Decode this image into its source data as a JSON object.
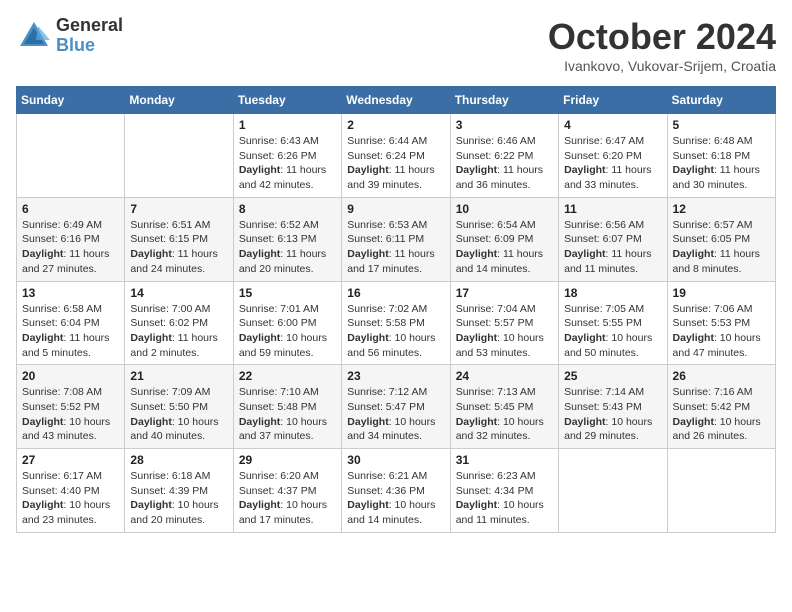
{
  "logo": {
    "general": "General",
    "blue": "Blue"
  },
  "title": "October 2024",
  "location": "Ivankovo, Vukovar-Srijem, Croatia",
  "days_of_week": [
    "Sunday",
    "Monday",
    "Tuesday",
    "Wednesday",
    "Thursday",
    "Friday",
    "Saturday"
  ],
  "weeks": [
    [
      {
        "day": null,
        "data": null
      },
      {
        "day": null,
        "data": null
      },
      {
        "day": "1",
        "data": "Sunrise: 6:43 AM\nSunset: 6:26 PM\nDaylight: 11 hours and 42 minutes."
      },
      {
        "day": "2",
        "data": "Sunrise: 6:44 AM\nSunset: 6:24 PM\nDaylight: 11 hours and 39 minutes."
      },
      {
        "day": "3",
        "data": "Sunrise: 6:46 AM\nSunset: 6:22 PM\nDaylight: 11 hours and 36 minutes."
      },
      {
        "day": "4",
        "data": "Sunrise: 6:47 AM\nSunset: 6:20 PM\nDaylight: 11 hours and 33 minutes."
      },
      {
        "day": "5",
        "data": "Sunrise: 6:48 AM\nSunset: 6:18 PM\nDaylight: 11 hours and 30 minutes."
      }
    ],
    [
      {
        "day": "6",
        "data": "Sunrise: 6:49 AM\nSunset: 6:16 PM\nDaylight: 11 hours and 27 minutes."
      },
      {
        "day": "7",
        "data": "Sunrise: 6:51 AM\nSunset: 6:15 PM\nDaylight: 11 hours and 24 minutes."
      },
      {
        "day": "8",
        "data": "Sunrise: 6:52 AM\nSunset: 6:13 PM\nDaylight: 11 hours and 20 minutes."
      },
      {
        "day": "9",
        "data": "Sunrise: 6:53 AM\nSunset: 6:11 PM\nDaylight: 11 hours and 17 minutes."
      },
      {
        "day": "10",
        "data": "Sunrise: 6:54 AM\nSunset: 6:09 PM\nDaylight: 11 hours and 14 minutes."
      },
      {
        "day": "11",
        "data": "Sunrise: 6:56 AM\nSunset: 6:07 PM\nDaylight: 11 hours and 11 minutes."
      },
      {
        "day": "12",
        "data": "Sunrise: 6:57 AM\nSunset: 6:05 PM\nDaylight: 11 hours and 8 minutes."
      }
    ],
    [
      {
        "day": "13",
        "data": "Sunrise: 6:58 AM\nSunset: 6:04 PM\nDaylight: 11 hours and 5 minutes."
      },
      {
        "day": "14",
        "data": "Sunrise: 7:00 AM\nSunset: 6:02 PM\nDaylight: 11 hours and 2 minutes."
      },
      {
        "day": "15",
        "data": "Sunrise: 7:01 AM\nSunset: 6:00 PM\nDaylight: 10 hours and 59 minutes."
      },
      {
        "day": "16",
        "data": "Sunrise: 7:02 AM\nSunset: 5:58 PM\nDaylight: 10 hours and 56 minutes."
      },
      {
        "day": "17",
        "data": "Sunrise: 7:04 AM\nSunset: 5:57 PM\nDaylight: 10 hours and 53 minutes."
      },
      {
        "day": "18",
        "data": "Sunrise: 7:05 AM\nSunset: 5:55 PM\nDaylight: 10 hours and 50 minutes."
      },
      {
        "day": "19",
        "data": "Sunrise: 7:06 AM\nSunset: 5:53 PM\nDaylight: 10 hours and 47 minutes."
      }
    ],
    [
      {
        "day": "20",
        "data": "Sunrise: 7:08 AM\nSunset: 5:52 PM\nDaylight: 10 hours and 43 minutes."
      },
      {
        "day": "21",
        "data": "Sunrise: 7:09 AM\nSunset: 5:50 PM\nDaylight: 10 hours and 40 minutes."
      },
      {
        "day": "22",
        "data": "Sunrise: 7:10 AM\nSunset: 5:48 PM\nDaylight: 10 hours and 37 minutes."
      },
      {
        "day": "23",
        "data": "Sunrise: 7:12 AM\nSunset: 5:47 PM\nDaylight: 10 hours and 34 minutes."
      },
      {
        "day": "24",
        "data": "Sunrise: 7:13 AM\nSunset: 5:45 PM\nDaylight: 10 hours and 32 minutes."
      },
      {
        "day": "25",
        "data": "Sunrise: 7:14 AM\nSunset: 5:43 PM\nDaylight: 10 hours and 29 minutes."
      },
      {
        "day": "26",
        "data": "Sunrise: 7:16 AM\nSunset: 5:42 PM\nDaylight: 10 hours and 26 minutes."
      }
    ],
    [
      {
        "day": "27",
        "data": "Sunrise: 6:17 AM\nSunset: 4:40 PM\nDaylight: 10 hours and 23 minutes."
      },
      {
        "day": "28",
        "data": "Sunrise: 6:18 AM\nSunset: 4:39 PM\nDaylight: 10 hours and 20 minutes."
      },
      {
        "day": "29",
        "data": "Sunrise: 6:20 AM\nSunset: 4:37 PM\nDaylight: 10 hours and 17 minutes."
      },
      {
        "day": "30",
        "data": "Sunrise: 6:21 AM\nSunset: 4:36 PM\nDaylight: 10 hours and 14 minutes."
      },
      {
        "day": "31",
        "data": "Sunrise: 6:23 AM\nSunset: 4:34 PM\nDaylight: 10 hours and 11 minutes."
      },
      {
        "day": null,
        "data": null
      },
      {
        "day": null,
        "data": null
      }
    ]
  ]
}
